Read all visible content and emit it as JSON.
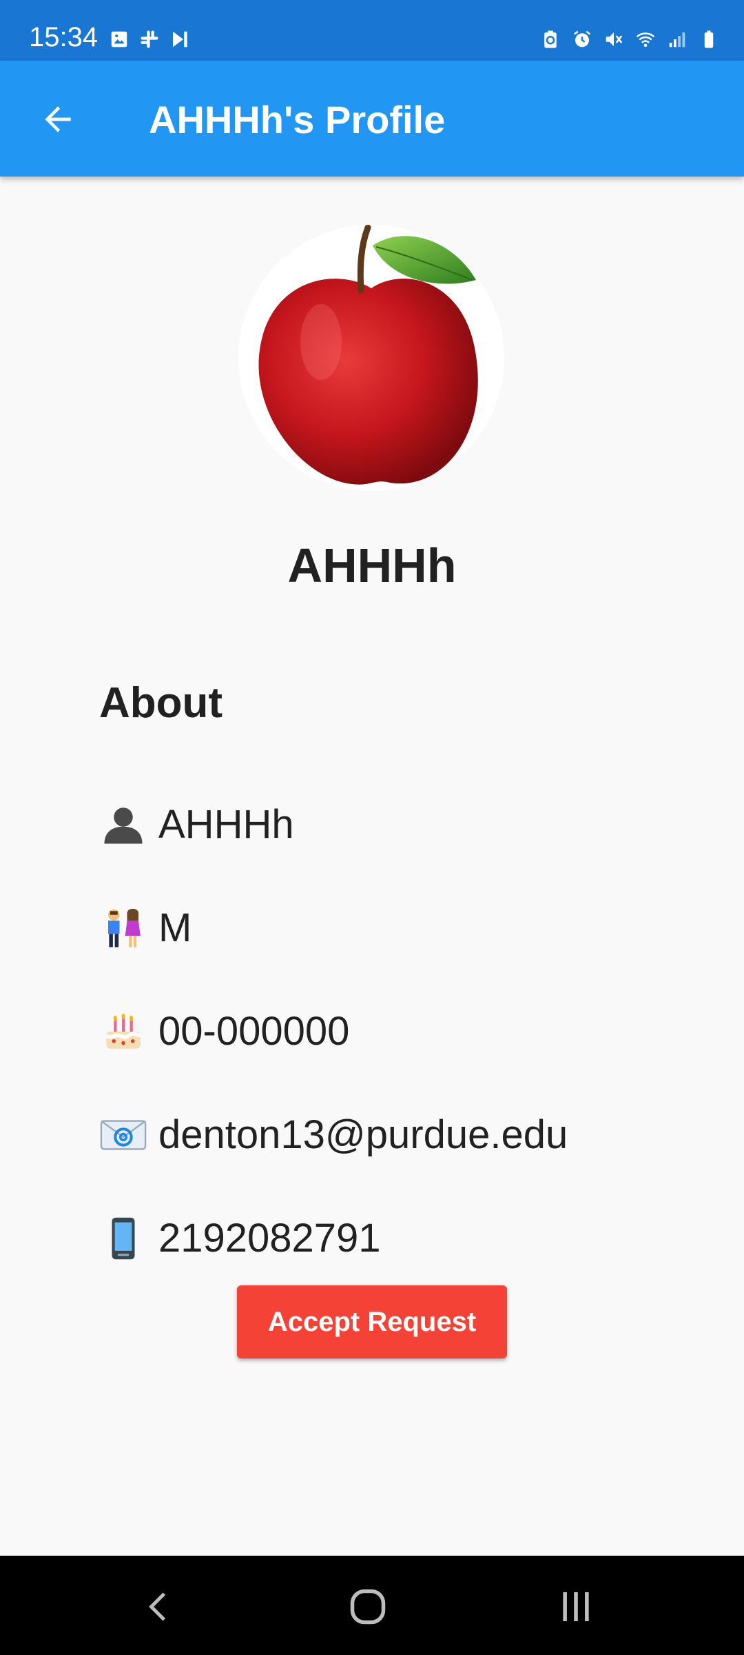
{
  "status_bar": {
    "time": "15:34",
    "left_icons": [
      "image-icon",
      "slack-icon",
      "media-play-icon"
    ],
    "right_icons": [
      "battery-saver-icon",
      "alarm-icon",
      "mute-icon",
      "wifi-icon",
      "signal-icon",
      "battery-icon"
    ]
  },
  "app_bar": {
    "title": "AHHHh's Profile",
    "back_icon": "arrow-back-icon"
  },
  "profile": {
    "avatar": "apple-image",
    "name": "AHHHh"
  },
  "about": {
    "heading": "About",
    "items": [
      {
        "icon": "bust-silhouette-icon",
        "text": "AHHHh"
      },
      {
        "icon": "couple-icon",
        "text": "M"
      },
      {
        "icon": "birthday-cake-icon",
        "text": "00-000000"
      },
      {
        "icon": "email-icon",
        "text": "denton13@purdue.edu"
      },
      {
        "icon": "mobile-phone-icon",
        "text": "2192082791"
      }
    ]
  },
  "actions": {
    "accept_label": "Accept Request",
    "accept_color": "#f44336"
  },
  "colors": {
    "status_bar": "#1976d2",
    "app_bar": "#2196f3",
    "background": "#f9f9f9"
  },
  "nav_bar": {
    "buttons": [
      "back-icon",
      "home-icon",
      "recents-icon"
    ]
  }
}
